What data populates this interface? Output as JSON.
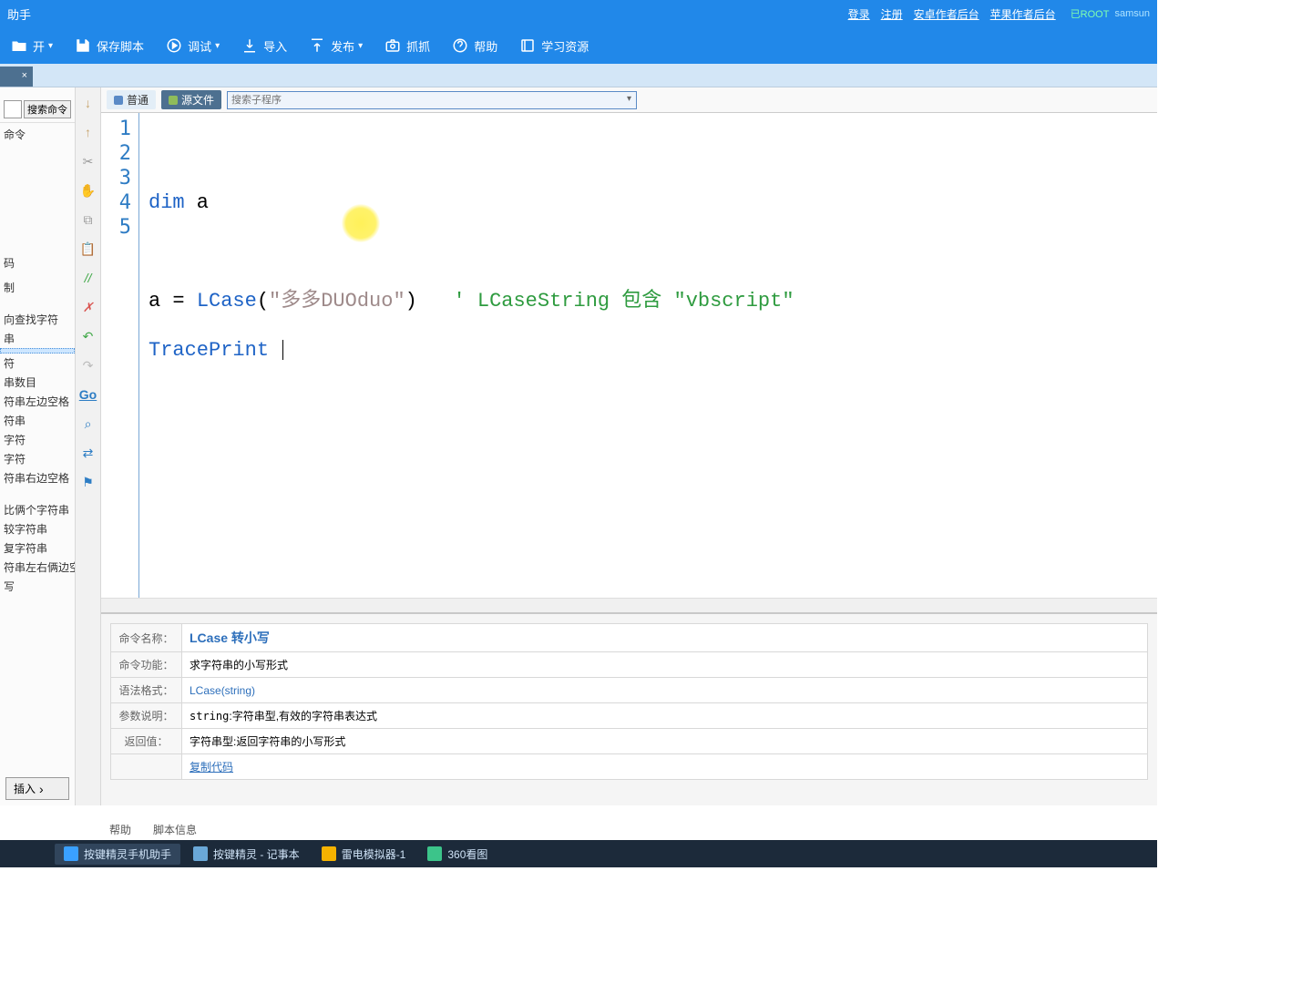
{
  "titlebar": {
    "title": "助手",
    "login": "登录",
    "register": "注册",
    "android_backend": "安卓作者后台",
    "ios_backend": "苹果作者后台",
    "root": "已ROOT",
    "device": "samsun"
  },
  "toolbar": {
    "open": "开",
    "save": "保存脚本",
    "debug": "调试",
    "import": "导入",
    "publish": "发布",
    "capture": "抓抓",
    "help": "帮助",
    "resources": "学习资源"
  },
  "tab": {
    "label": "",
    "close": "×"
  },
  "left": {
    "search_btn": "搜索命令",
    "search_placeholder": "",
    "cat": "命令",
    "items": [
      "码",
      "制",
      "向查找字符",
      "串",
      "符",
      "串数目",
      "符串左边空格",
      "符串",
      "字符",
      "字符",
      "符串右边空格",
      "比俩个字符串",
      "较字符串",
      "复字符串",
      "符串左右俩边空格",
      "写"
    ],
    "insert": "插入"
  },
  "editor_tb": {
    "normal": "普通",
    "source": "源文件",
    "sub_search_placeholder": "搜索子程序"
  },
  "code": {
    "lines": [
      "1",
      "2",
      "3",
      "4",
      "5"
    ],
    "l2_dim": "dim",
    "l2_var": " a",
    "l4_pre": "a = ",
    "l4_fn": "LCase",
    "l4_paren_open": "(",
    "l4_str": "\"多多DUOduo\"",
    "l4_paren_close": ")",
    "l4_cmt": "   ' LCaseString 包含 \"vbscript\"",
    "l5_fn": "TracePrint",
    "l5_rest": " "
  },
  "help": {
    "lbl_name": "命令名称：",
    "name": "LCase 转小写",
    "lbl_func": "命令功能：",
    "func": "求字符串的小写形式",
    "lbl_syntax": "语法格式：",
    "syntax": "LCase(string)",
    "lbl_params": "参数说明：",
    "params_code": "string",
    "params_text": ":字符串型,有效的字符串表达式",
    "lbl_return": "返回值：",
    "return": "字符串型:返回字符串的小写形式",
    "copy": "复制代码"
  },
  "bottom_tabs": {
    "help": "帮助",
    "info": "脚本信息"
  },
  "taskbar": {
    "t1": "按键精灵手机助手",
    "t2": "按键精灵 - 记事本",
    "t3": "雷电模拟器-1",
    "t4": "360看图"
  }
}
